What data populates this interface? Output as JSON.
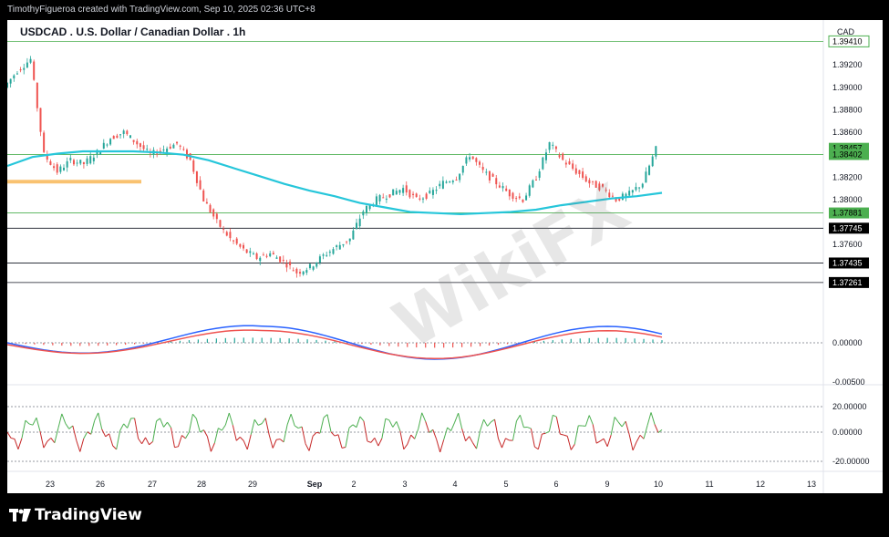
{
  "header": {
    "credit": "TimothyFigueroa created with TradingView.com, Sep 10, 2025 02:36 UTC+8"
  },
  "chart": {
    "title": "USDCAD . U.S. Dollar / Canadian Dollar . 1h",
    "currency": "CAD"
  },
  "footer": {
    "brand": "TradingView"
  },
  "watermark": {
    "text": "WikiFX"
  },
  "colors": {
    "up": "#26a69a",
    "down": "#ef5350",
    "ma": "#26c6da",
    "support": "#f9c270",
    "macd_fast": "#2962ff",
    "macd_slow": "#1b5e20",
    "rsi_up": "#4caf50",
    "rsi_down": "#c62828"
  },
  "chart_data": {
    "type": "line",
    "price_axis": {
      "min": 1.37,
      "max": 1.396,
      "ticks": [
        "1.39200",
        "1.39000",
        "1.38800",
        "1.38600",
        "1.38200",
        "1.38000",
        "1.37600"
      ]
    },
    "x_ticks": [
      "23",
      "26",
      "27",
      "28",
      "29",
      "Sep",
      "2",
      "3",
      "4",
      "5",
      "6",
      "9",
      "10",
      "11",
      "12",
      "13"
    ],
    "price_tags": [
      {
        "value": "1.39410",
        "style": "green-outline"
      },
      {
        "value": "1.38457",
        "style": "green"
      },
      {
        "value": "1.38402",
        "style": "green"
      },
      {
        "value": "1.37881",
        "style": "green"
      },
      {
        "value": "1.37745",
        "style": "black"
      },
      {
        "value": "1.37435",
        "style": "black"
      },
      {
        "value": "1.37261",
        "style": "black"
      }
    ],
    "horizontal_levels": [
      1.3941,
      1.38402,
      1.37881,
      1.37745,
      1.37435,
      1.37261
    ],
    "support_zone": 1.3816,
    "price_path": [
      1.39,
      1.3915,
      1.3925,
      1.384,
      1.3825,
      1.3835,
      1.3832,
      1.3842,
      1.3855,
      1.386,
      1.385,
      1.384,
      1.3845,
      1.385,
      1.3835,
      1.38,
      1.378,
      1.3765,
      1.3755,
      1.3748,
      1.3752,
      1.3745,
      1.3735,
      1.374,
      1.375,
      1.3758,
      1.3765,
      1.379,
      1.38,
      1.3805,
      1.381,
      1.38,
      1.3805,
      1.3815,
      1.382,
      1.384,
      1.3825,
      1.3815,
      1.3805,
      1.38,
      1.382,
      1.385,
      1.3835,
      1.3825,
      1.3815,
      1.381,
      1.38,
      1.3805,
      1.3815,
      1.3845
    ],
    "ma_path": [
      1.383,
      1.3838,
      1.3841,
      1.3843,
      1.3843,
      1.3843,
      1.3842,
      1.384,
      1.3835,
      1.3828,
      1.3821,
      1.3814,
      1.3808,
      1.3803,
      1.3797,
      1.3793,
      1.3789,
      1.3788,
      1.3787,
      1.3788,
      1.3789,
      1.3791,
      1.3795,
      1.3798,
      1.3801,
      1.3803,
      1.3806
    ],
    "macd_axis": {
      "ticks": [
        "0.00000",
        "-0.00500"
      ]
    },
    "rsi_axis": {
      "ticks": [
        "20.00000",
        "0.00000",
        "-20.00000"
      ]
    }
  }
}
